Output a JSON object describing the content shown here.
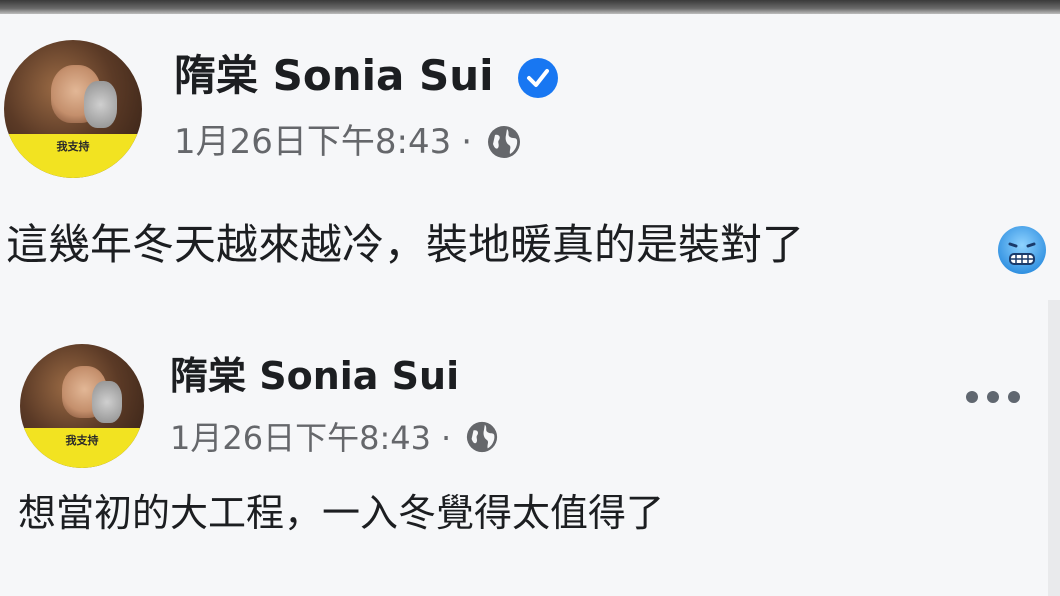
{
  "posts": [
    {
      "author": "隋棠 Sonia Sui",
      "verified": true,
      "timestamp": "1月26日下午8:43",
      "separator": "·",
      "privacy_icon": "globe-icon",
      "text": "這幾年冬天越來越冷，裝地暖真的是裝對了",
      "emoji": "cold-face-emoji",
      "avatar_banner": "我支持"
    },
    {
      "author": "隋棠 Sonia Sui",
      "verified": false,
      "timestamp": "1月26日下午8:43",
      "separator": "·",
      "privacy_icon": "globe-icon",
      "text": "想當初的大工程，一入冬覺得太值得了",
      "more_icon": "more-options-icon",
      "avatar_banner": "我支持"
    }
  ],
  "colors": {
    "verified_badge": "#1877f2",
    "meta_text": "#65676b",
    "body_text": "#1c1e21"
  }
}
